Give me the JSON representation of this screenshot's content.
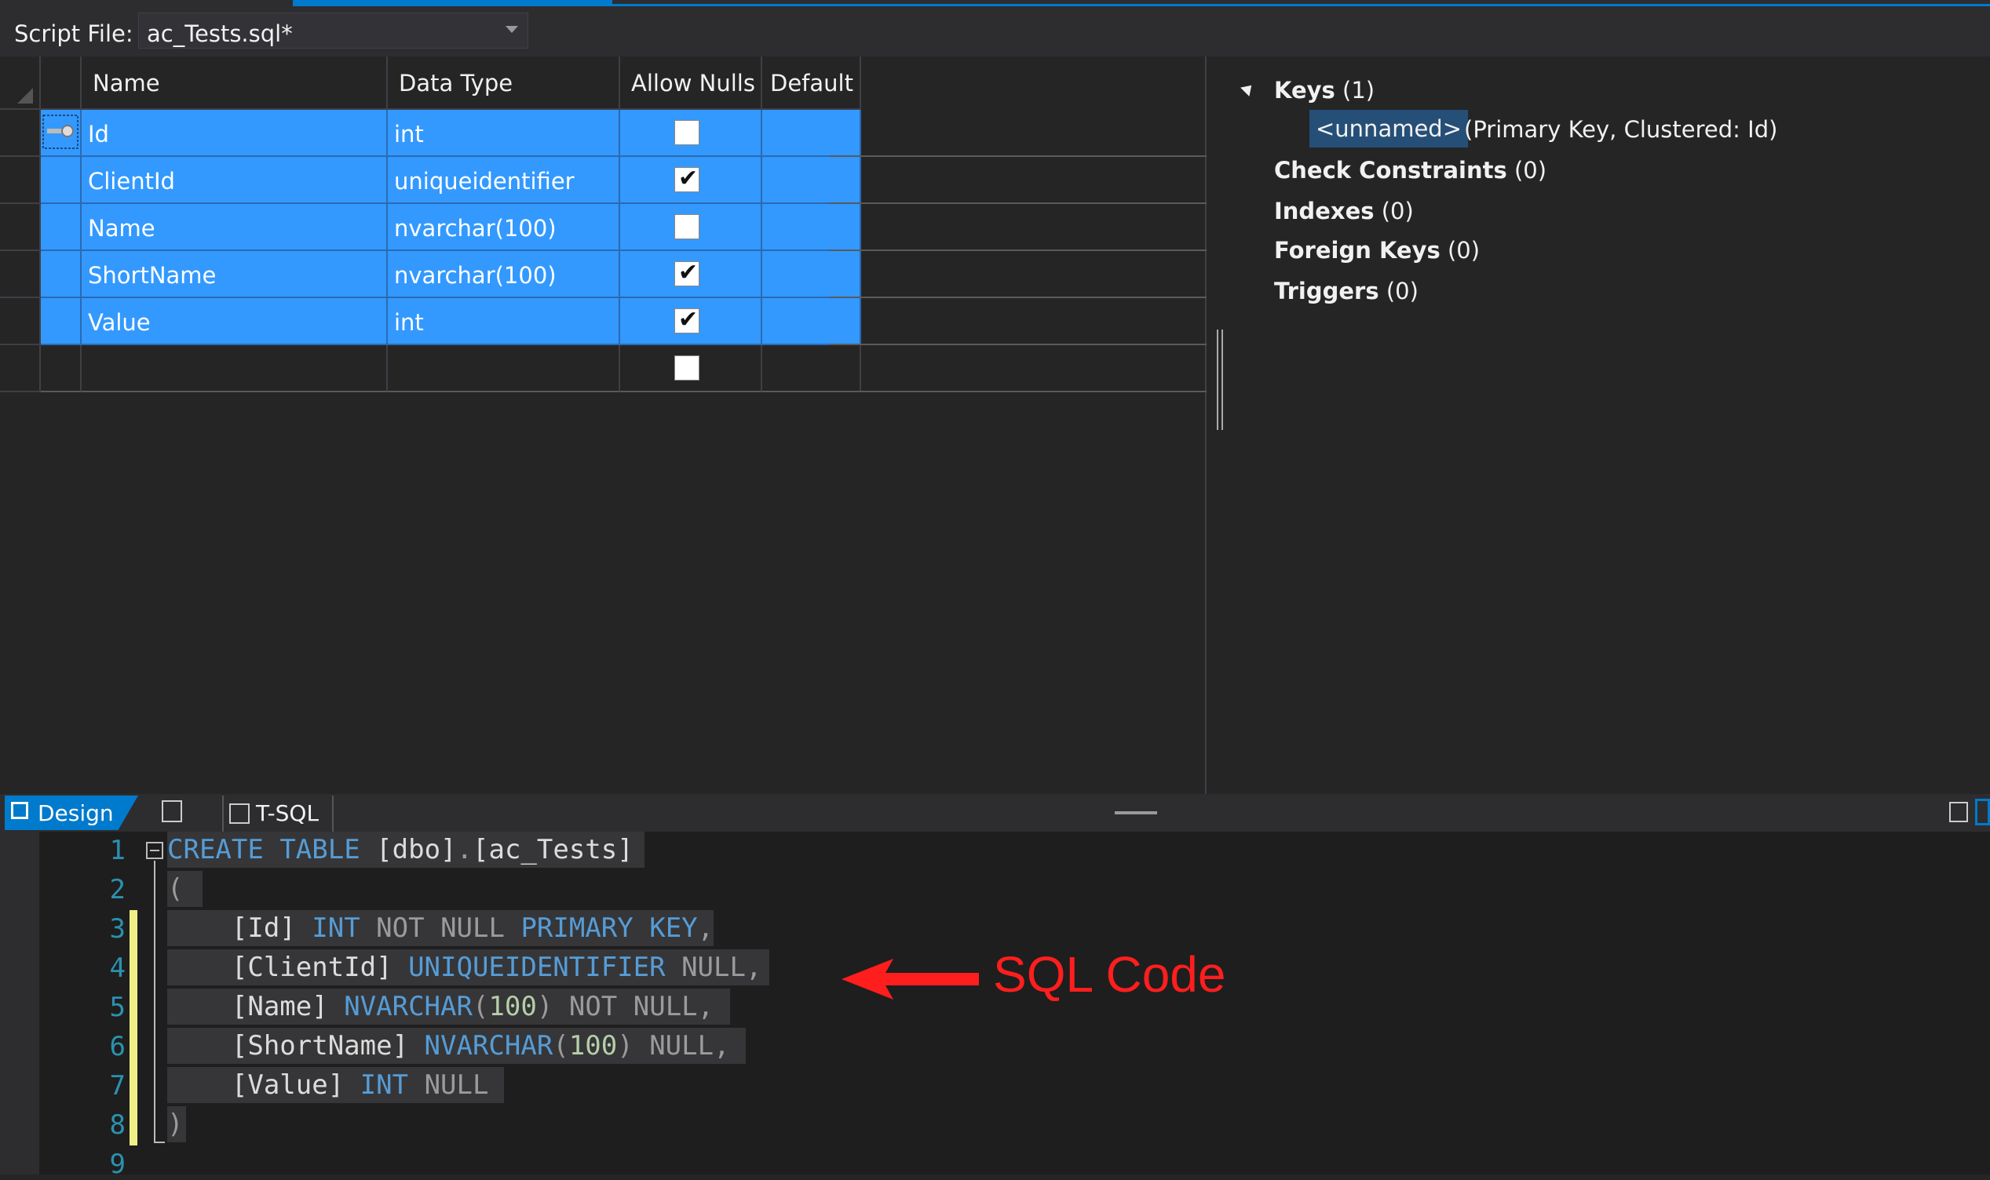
{
  "script_bar": {
    "label": "Script File:",
    "file": "ac_Tests.sql*"
  },
  "grid": {
    "headers": [
      "Name",
      "Data Type",
      "Allow Nulls",
      "Default"
    ],
    "rows": [
      {
        "name": "Id",
        "type": "int",
        "allow_nulls": false,
        "default": "",
        "primary_key": true
      },
      {
        "name": "ClientId",
        "type": "uniqueidentifier",
        "allow_nulls": true,
        "default": ""
      },
      {
        "name": "Name",
        "type": "nvarchar(100)",
        "allow_nulls": false,
        "default": ""
      },
      {
        "name": "ShortName",
        "type": "nvarchar(100)",
        "allow_nulls": true,
        "default": ""
      },
      {
        "name": "Value",
        "type": "int",
        "allow_nulls": true,
        "default": ""
      },
      {
        "name": "",
        "type": "",
        "allow_nulls": false,
        "default": ""
      }
    ],
    "check_mark": "✔"
  },
  "properties": {
    "keys": {
      "label": "Keys",
      "count": "(1)"
    },
    "key_item": {
      "name": "<unnamed>",
      "detail": "(Primary Key, Clustered: Id)"
    },
    "check_constraints": {
      "label": "Check Constraints",
      "count": "(0)"
    },
    "indexes": {
      "label": "Indexes",
      "count": "(0)"
    },
    "foreign_keys": {
      "label": "Foreign Keys",
      "count": "(0)"
    },
    "triggers": {
      "label": "Triggers",
      "count": "(0)"
    }
  },
  "tabs": {
    "design": "Design",
    "tsql": "T-SQL"
  },
  "editor": {
    "line_numbers": [
      "1",
      "2",
      "3",
      "4",
      "5",
      "6",
      "7",
      "8",
      "9"
    ]
  },
  "annotation": {
    "label": "SQL Code",
    "color": "#ff1e1e"
  },
  "colors": {
    "selection": "#3399ff",
    "accent": "#007acc",
    "keyword": "#569cd6"
  }
}
